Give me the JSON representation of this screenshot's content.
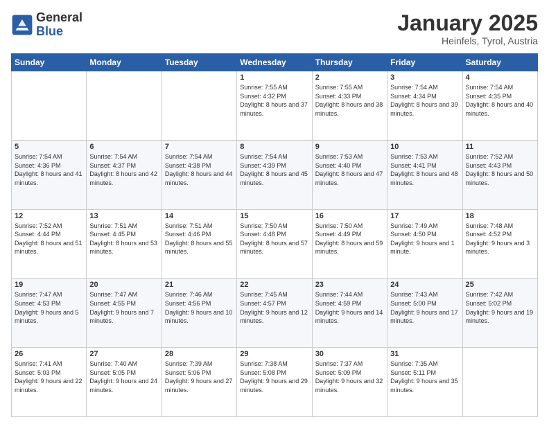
{
  "header": {
    "logo_general": "General",
    "logo_blue": "Blue",
    "month_title": "January 2025",
    "location": "Heinfels, Tyrol, Austria"
  },
  "weekdays": [
    "Sunday",
    "Monday",
    "Tuesday",
    "Wednesday",
    "Thursday",
    "Friday",
    "Saturday"
  ],
  "weeks": [
    [
      {
        "day": "",
        "sunrise": "",
        "sunset": "",
        "daylight": ""
      },
      {
        "day": "",
        "sunrise": "",
        "sunset": "",
        "daylight": ""
      },
      {
        "day": "",
        "sunrise": "",
        "sunset": "",
        "daylight": ""
      },
      {
        "day": "1",
        "sunrise": "7:55 AM",
        "sunset": "4:32 PM",
        "daylight": "8 hours and 37 minutes."
      },
      {
        "day": "2",
        "sunrise": "7:55 AM",
        "sunset": "4:33 PM",
        "daylight": "8 hours and 38 minutes."
      },
      {
        "day": "3",
        "sunrise": "7:54 AM",
        "sunset": "4:34 PM",
        "daylight": "8 hours and 39 minutes."
      },
      {
        "day": "4",
        "sunrise": "7:54 AM",
        "sunset": "4:35 PM",
        "daylight": "8 hours and 40 minutes."
      }
    ],
    [
      {
        "day": "5",
        "sunrise": "7:54 AM",
        "sunset": "4:36 PM",
        "daylight": "8 hours and 41 minutes."
      },
      {
        "day": "6",
        "sunrise": "7:54 AM",
        "sunset": "4:37 PM",
        "daylight": "8 hours and 42 minutes."
      },
      {
        "day": "7",
        "sunrise": "7:54 AM",
        "sunset": "4:38 PM",
        "daylight": "8 hours and 44 minutes."
      },
      {
        "day": "8",
        "sunrise": "7:54 AM",
        "sunset": "4:39 PM",
        "daylight": "8 hours and 45 minutes."
      },
      {
        "day": "9",
        "sunrise": "7:53 AM",
        "sunset": "4:40 PM",
        "daylight": "8 hours and 47 minutes."
      },
      {
        "day": "10",
        "sunrise": "7:53 AM",
        "sunset": "4:41 PM",
        "daylight": "8 hours and 48 minutes."
      },
      {
        "day": "11",
        "sunrise": "7:52 AM",
        "sunset": "4:43 PM",
        "daylight": "8 hours and 50 minutes."
      }
    ],
    [
      {
        "day": "12",
        "sunrise": "7:52 AM",
        "sunset": "4:44 PM",
        "daylight": "8 hours and 51 minutes."
      },
      {
        "day": "13",
        "sunrise": "7:51 AM",
        "sunset": "4:45 PM",
        "daylight": "8 hours and 53 minutes."
      },
      {
        "day": "14",
        "sunrise": "7:51 AM",
        "sunset": "4:46 PM",
        "daylight": "8 hours and 55 minutes."
      },
      {
        "day": "15",
        "sunrise": "7:50 AM",
        "sunset": "4:48 PM",
        "daylight": "8 hours and 57 minutes."
      },
      {
        "day": "16",
        "sunrise": "7:50 AM",
        "sunset": "4:49 PM",
        "daylight": "8 hours and 59 minutes."
      },
      {
        "day": "17",
        "sunrise": "7:49 AM",
        "sunset": "4:50 PM",
        "daylight": "9 hours and 1 minute."
      },
      {
        "day": "18",
        "sunrise": "7:48 AM",
        "sunset": "4:52 PM",
        "daylight": "9 hours and 3 minutes."
      }
    ],
    [
      {
        "day": "19",
        "sunrise": "7:47 AM",
        "sunset": "4:53 PM",
        "daylight": "9 hours and 5 minutes."
      },
      {
        "day": "20",
        "sunrise": "7:47 AM",
        "sunset": "4:55 PM",
        "daylight": "9 hours and 7 minutes."
      },
      {
        "day": "21",
        "sunrise": "7:46 AM",
        "sunset": "4:56 PM",
        "daylight": "9 hours and 10 minutes."
      },
      {
        "day": "22",
        "sunrise": "7:45 AM",
        "sunset": "4:57 PM",
        "daylight": "9 hours and 12 minutes."
      },
      {
        "day": "23",
        "sunrise": "7:44 AM",
        "sunset": "4:59 PM",
        "daylight": "9 hours and 14 minutes."
      },
      {
        "day": "24",
        "sunrise": "7:43 AM",
        "sunset": "5:00 PM",
        "daylight": "9 hours and 17 minutes."
      },
      {
        "day": "25",
        "sunrise": "7:42 AM",
        "sunset": "5:02 PM",
        "daylight": "9 hours and 19 minutes."
      }
    ],
    [
      {
        "day": "26",
        "sunrise": "7:41 AM",
        "sunset": "5:03 PM",
        "daylight": "9 hours and 22 minutes."
      },
      {
        "day": "27",
        "sunrise": "7:40 AM",
        "sunset": "5:05 PM",
        "daylight": "9 hours and 24 minutes."
      },
      {
        "day": "28",
        "sunrise": "7:39 AM",
        "sunset": "5:06 PM",
        "daylight": "9 hours and 27 minutes."
      },
      {
        "day": "29",
        "sunrise": "7:38 AM",
        "sunset": "5:08 PM",
        "daylight": "9 hours and 29 minutes."
      },
      {
        "day": "30",
        "sunrise": "7:37 AM",
        "sunset": "5:09 PM",
        "daylight": "9 hours and 32 minutes."
      },
      {
        "day": "31",
        "sunrise": "7:35 AM",
        "sunset": "5:11 PM",
        "daylight": "9 hours and 35 minutes."
      },
      {
        "day": "",
        "sunrise": "",
        "sunset": "",
        "daylight": ""
      }
    ]
  ],
  "labels": {
    "sunrise_prefix": "Sunrise: ",
    "sunset_prefix": "Sunset: ",
    "daylight_prefix": "Daylight: "
  }
}
